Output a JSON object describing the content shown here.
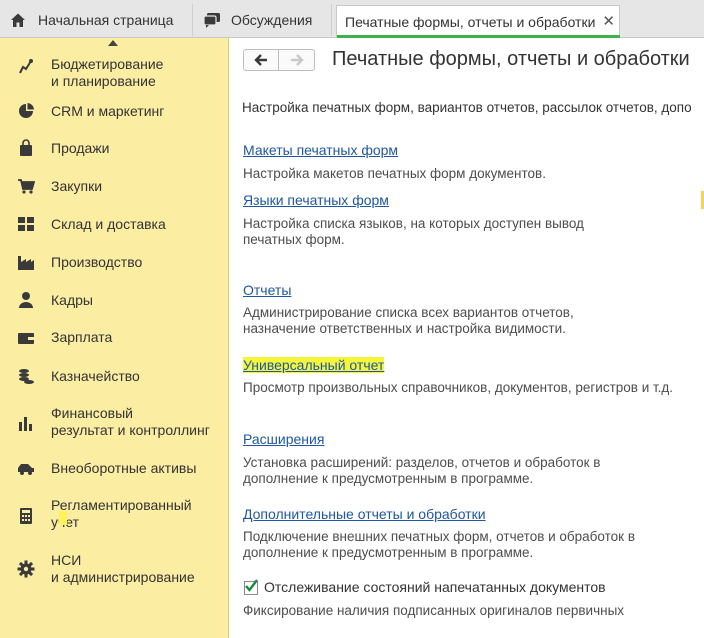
{
  "tabs": [
    {
      "label": "Начальная страница",
      "icon": "home-icon"
    },
    {
      "label": "Обсуждения",
      "icon": "discussions-icon"
    },
    {
      "label": "Печатные формы, отчеты и обработки",
      "icon": "",
      "active": true,
      "close": "✕"
    }
  ],
  "sidebar": {
    "items": [
      {
        "label": "Бюджетирование\nи планирование",
        "icon": "budget-icon"
      },
      {
        "label": "CRM и маркетинг",
        "icon": "pie-chart-icon"
      },
      {
        "label": "Продажи",
        "icon": "bag-icon"
      },
      {
        "label": "Закупки",
        "icon": "cart-icon"
      },
      {
        "label": "Склад и доставка",
        "icon": "warehouse-icon"
      },
      {
        "label": "Производство",
        "icon": "factory-icon"
      },
      {
        "label": "Кадры",
        "icon": "person-icon"
      },
      {
        "label": "Зарплата",
        "icon": "wallet-icon"
      },
      {
        "label": "Казначейство",
        "icon": "coins-icon"
      },
      {
        "label": "Финансовый\nрезультат и контроллинг",
        "icon": "bar-chart-icon"
      },
      {
        "label": "Внеоборотные активы",
        "icon": "car-icon"
      },
      {
        "label": "Регламентированный\nучет",
        "icon": "calculator-icon"
      },
      {
        "label": "НСИ\nи администрирование",
        "icon": "gear-icon"
      }
    ]
  },
  "content": {
    "title": "Печатные формы, отчеты и обработки",
    "intro": "Настройка печатных форм, вариантов отчетов, рассылок отчетов, допо",
    "sections": [
      {
        "link": "Макеты печатных форм",
        "desc": "Настройка макетов печатных форм документов."
      },
      {
        "link": "Языки печатных форм",
        "desc": "Настройка списка языков, на которых доступен вывод\nпечатных форм."
      },
      {
        "link": "Отчеты",
        "desc": "Администрирование списка всех вариантов отчетов,\nназначение ответственных и настройка видимости."
      },
      {
        "link": "Универсальный отчет",
        "desc": "Просмотр произвольных справочников, документов, регистров и т.д."
      },
      {
        "link": "Расширения",
        "desc": "Установка расширений: разделов, отчетов и обработок в\nдополнение к предусмотренным в программе."
      },
      {
        "link": "Дополнительные отчеты и обработки",
        "desc": "Подключение внешних печатных форм, отчетов и обработок в\nдополнение к предусмотренным в программе."
      }
    ],
    "tracking": {
      "label": "Отслеживание состояний напечатанных документов",
      "checked": true,
      "desc": "Фиксирование наличия подписанных оригиналов первичных"
    },
    "colors": {
      "link": "#1e56a8",
      "sidebar": "#fbeda2",
      "highlight": "#f5f53a",
      "check": "#1a8a3a"
    }
  }
}
